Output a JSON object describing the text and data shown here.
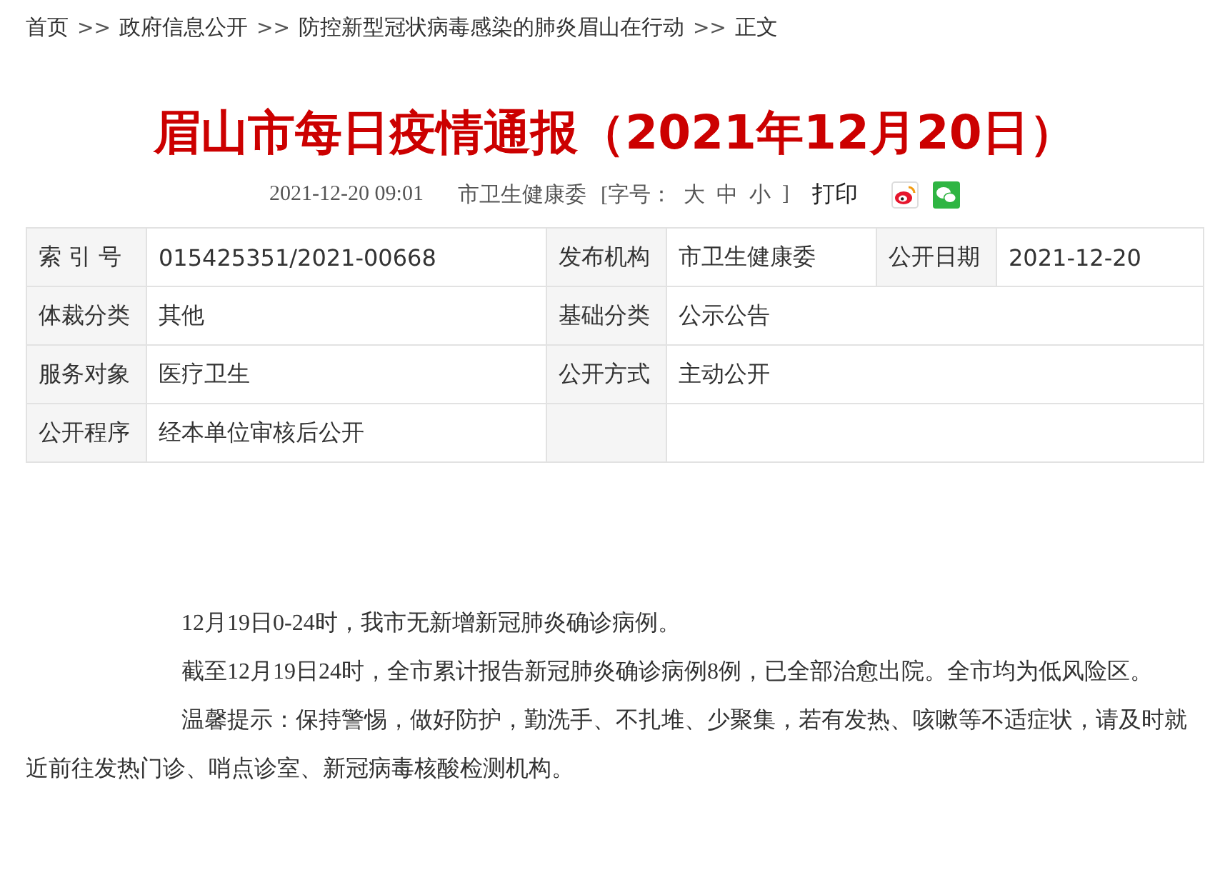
{
  "breadcrumb": {
    "separator": ">>",
    "items": [
      {
        "label": "首页"
      },
      {
        "label": "政府信息公开"
      },
      {
        "label": "防控新型冠状病毒感染的肺炎眉山在行动"
      },
      {
        "label": "正文"
      }
    ]
  },
  "article": {
    "title": "眉山市每日疫情通报（2021年12月20日）",
    "meta": {
      "date": "2021-12-20 09:01",
      "source": "市卫生健康委",
      "font_size_open": "[字号：",
      "font_sizes": [
        "大",
        "中",
        "小"
      ],
      "font_size_close": "]",
      "print": "打印"
    },
    "info_table": {
      "rows": [
        {
          "cells": [
            {
              "label": "索 引 号",
              "value": "015425351/2021-00668"
            },
            {
              "label": "发布机构",
              "value": "市卫生健康委"
            },
            {
              "label": "公开日期",
              "value": "2021-12-20"
            }
          ]
        },
        {
          "cells": [
            {
              "label": "体裁分类",
              "value": "其他"
            },
            {
              "label": "基础分类",
              "value": "公示公告"
            }
          ]
        },
        {
          "cells": [
            {
              "label": "服务对象",
              "value": "医疗卫生"
            },
            {
              "label": "公开方式",
              "value": "主动公开"
            }
          ]
        },
        {
          "cells": [
            {
              "label": "公开程序",
              "value": "经本单位审核后公开"
            }
          ]
        }
      ]
    },
    "paragraphs": [
      "12月19日0-24时，我市无新增新冠肺炎确诊病例。",
      "截至12月19日24时，全市累计报告新冠肺炎确诊病例8例，已全部治愈出院。全市均为低风险区。",
      "温馨提示：保持警惕，做好防护，勤洗手、不扎堆、少聚集，若有发热、咳嗽等不适症状，请及时就近前往发热门诊、哨点诊室、新冠病毒核酸检测机构。"
    ]
  }
}
